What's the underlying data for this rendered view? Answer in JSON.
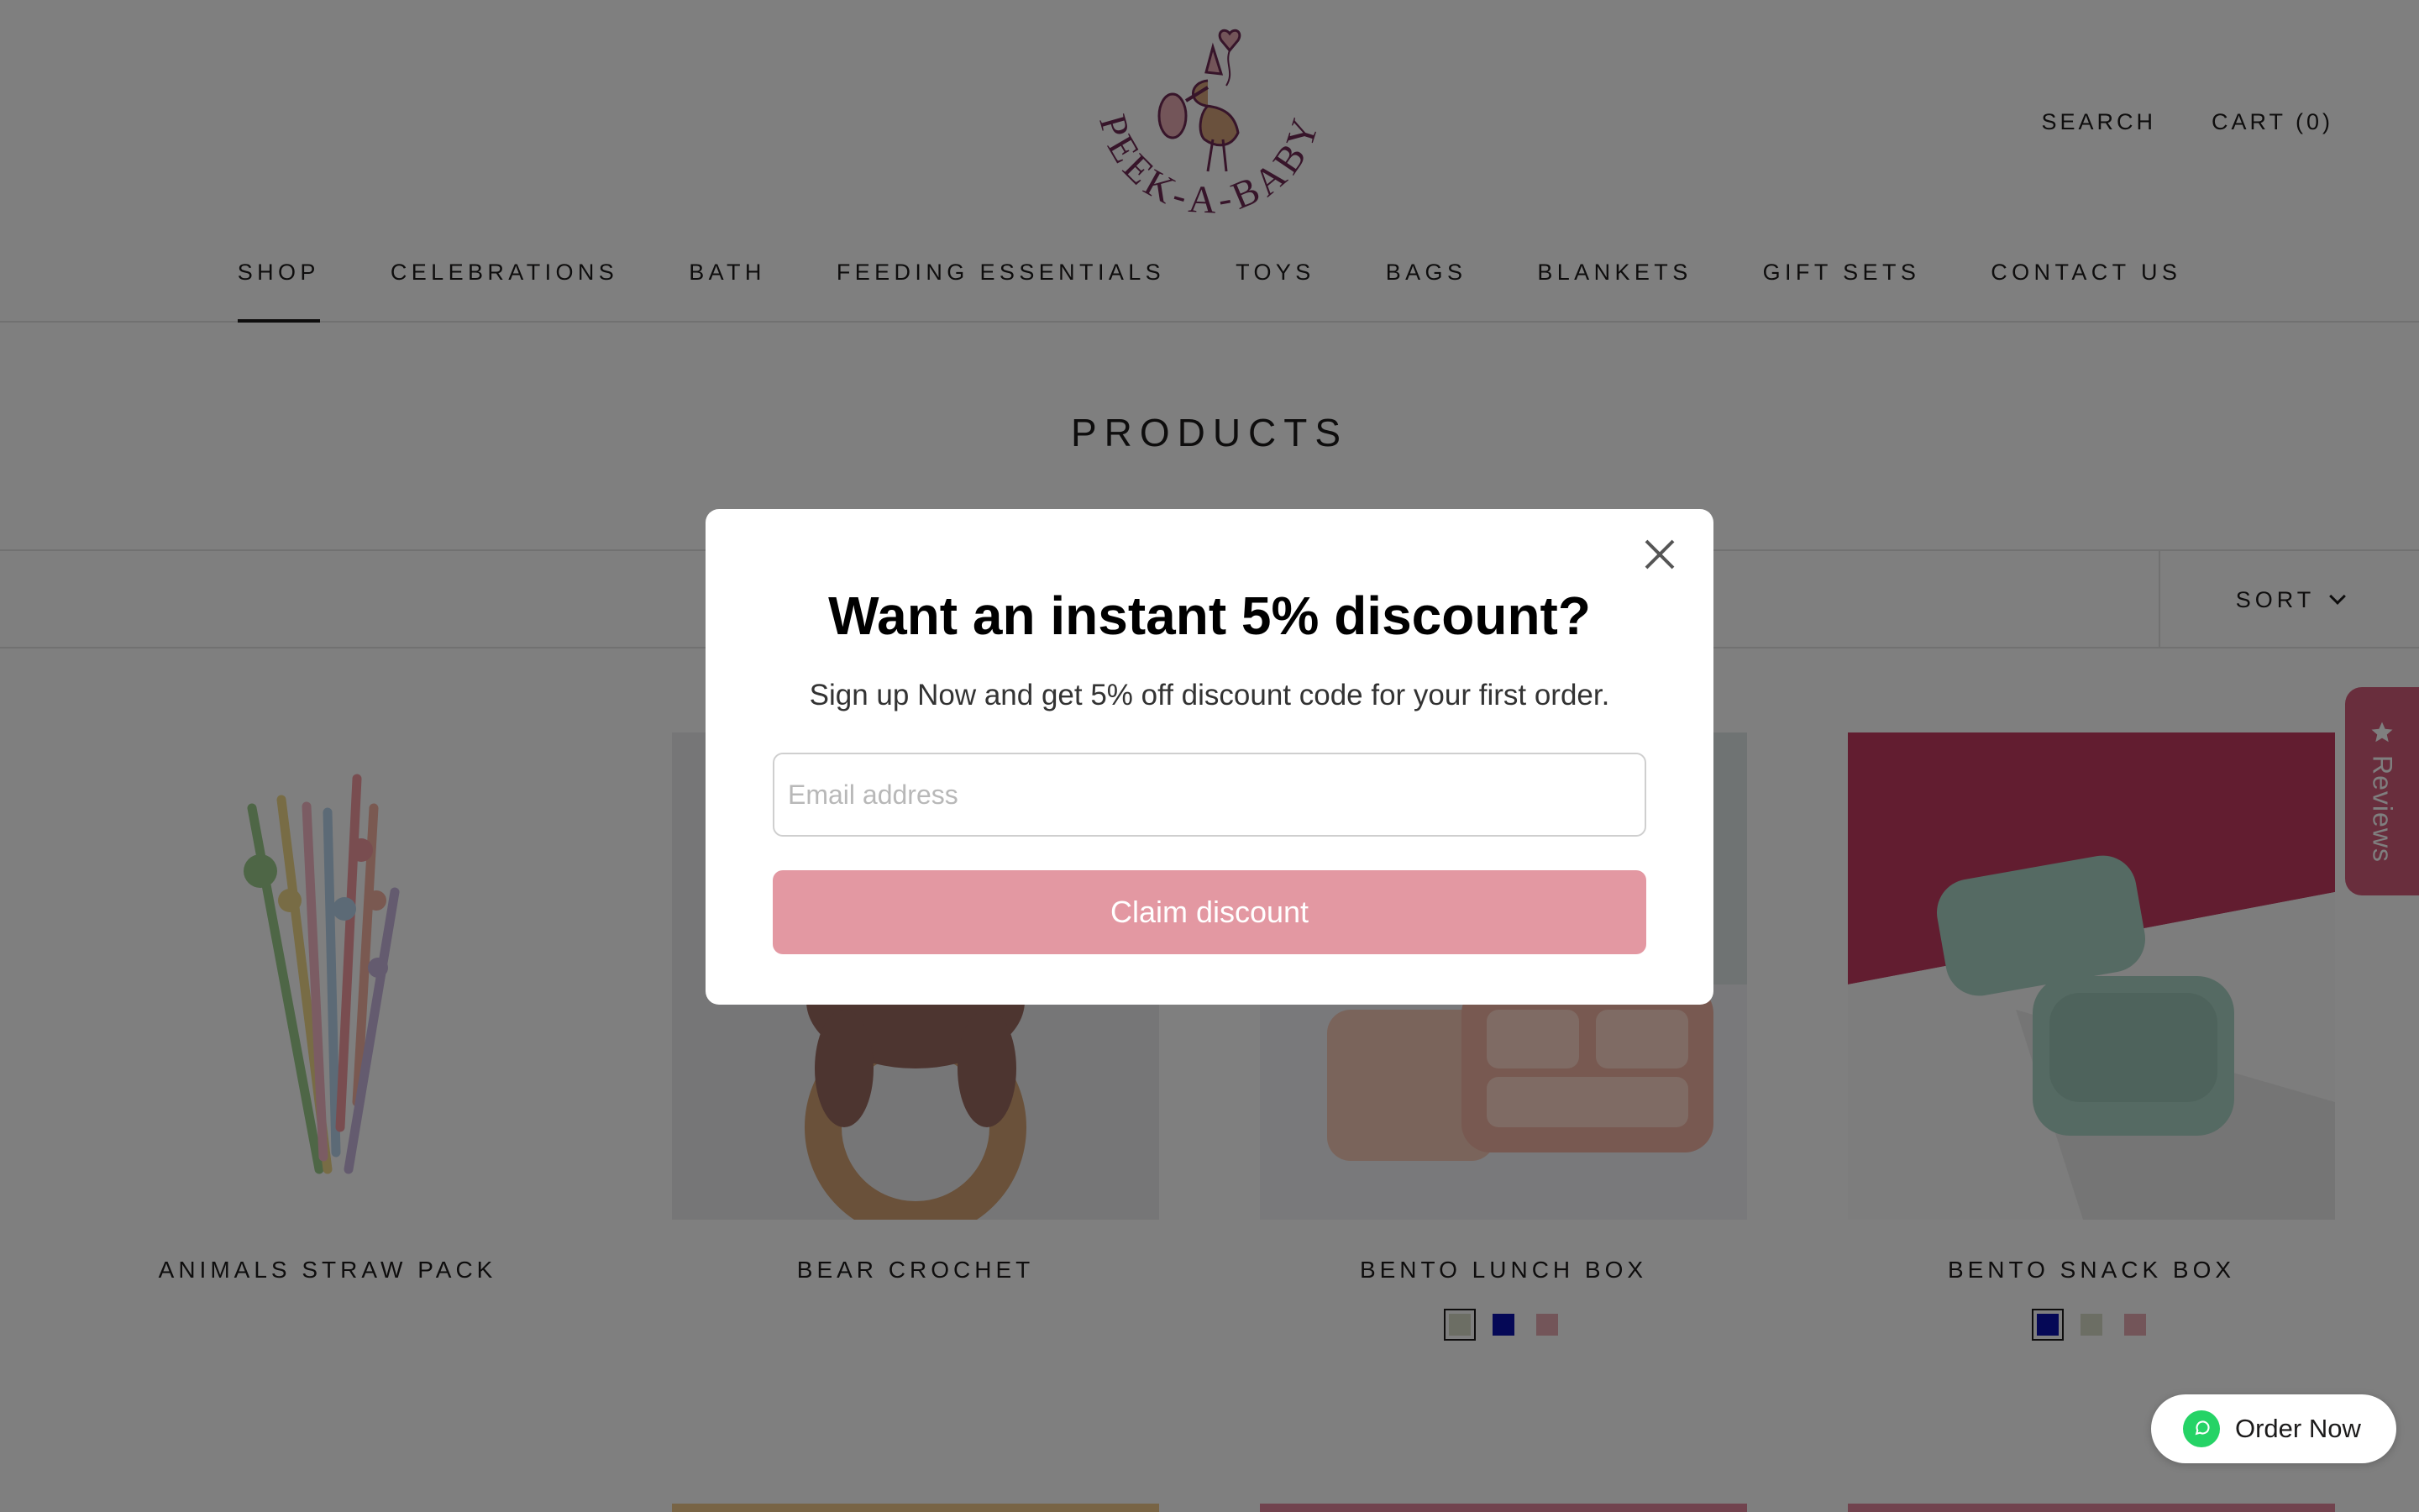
{
  "header": {
    "logo_text": "PEEK-A-BABY",
    "search_label": "SEARCH",
    "cart_label": "CART (0)"
  },
  "nav": {
    "items": [
      {
        "label": "SHOP",
        "active": true
      },
      {
        "label": "CELEBRATIONS"
      },
      {
        "label": "BATH"
      },
      {
        "label": "FEEDING ESSENTIALS"
      },
      {
        "label": "TOYS"
      },
      {
        "label": "BAGS"
      },
      {
        "label": "BLANKETS"
      },
      {
        "label": "GIFT SETS"
      },
      {
        "label": "CONTACT US"
      }
    ]
  },
  "page": {
    "title": "PRODUCTS",
    "sort_label": "SORT"
  },
  "products": [
    {
      "name": "ANIMALS STRAW PACK"
    },
    {
      "name": "BEAR CROCHET"
    },
    {
      "name": "BENTO LUNCH BOX",
      "swatches": [
        {
          "color": "#d9dcc9",
          "selected": true
        },
        {
          "color": "#0a10ad"
        },
        {
          "color": "#e7aab3"
        }
      ]
    },
    {
      "name": "BENTO SNACK BOX",
      "swatches": [
        {
          "color": "#0a10ad",
          "selected": true
        },
        {
          "color": "#d9dcc9"
        },
        {
          "color": "#e7aab3"
        }
      ]
    }
  ],
  "reviews_tab": {
    "label": "Reviews"
  },
  "order_now": {
    "label": "Order Now"
  },
  "modal": {
    "title": "Want an instant 5% discount?",
    "subtitle": "Sign up Now and get 5% off discount code for your first order.",
    "email_placeholder": "Email address",
    "button_label": "Claim discount"
  },
  "colors": {
    "accent_pink": "#e398a2",
    "reviews_tab": "#d35c7b",
    "whatsapp_green": "#25d366",
    "logo_purple": "#6e2a55"
  }
}
